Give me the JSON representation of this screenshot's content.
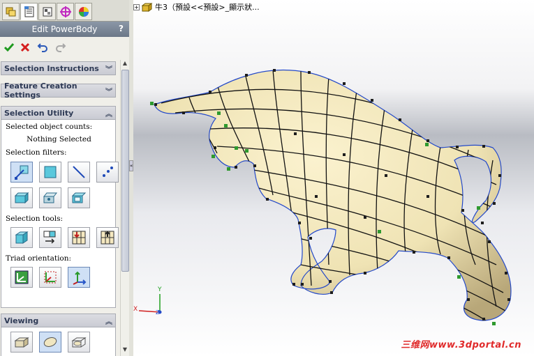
{
  "tabs": [
    {
      "name": "feature-manager-tab",
      "icon": "feature-tree-icon"
    },
    {
      "name": "property-manager-tab",
      "icon": "property-sheet-icon"
    },
    {
      "name": "configuration-manager-tab",
      "icon": "configuration-icon"
    },
    {
      "name": "dimxpert-tab",
      "icon": "crosshair-icon"
    },
    {
      "name": "display-manager-tab",
      "icon": "color-wheel-icon"
    }
  ],
  "panel": {
    "title": "Edit PowerBody",
    "help": "?"
  },
  "groups": {
    "selection_instructions": "Selection Instructions",
    "feature_creation": "Feature Creation Settings",
    "selection_utility": "Selection Utility",
    "viewing": "Viewing"
  },
  "selection_utility": {
    "counts_label": "Selected object counts:",
    "counts_value": "Nothing Selected",
    "filters_label": "Selection filters:",
    "tools_label": "Selection tools:",
    "triad_label": "Triad orientation:"
  },
  "viewport": {
    "tree_label": "牛3（預設<<預設>_顯示狀..."
  },
  "watermark": "三维网www.3dportal.cn",
  "colors": {
    "model_fill": "#efe3b4",
    "model_shade": "#b8a779",
    "edge": "#111111",
    "vertex": "#1d1d1d",
    "selected_vertex": "#2f9a2f",
    "accent_blue": "#2449c9",
    "watermark_red": "#e02a2a"
  }
}
